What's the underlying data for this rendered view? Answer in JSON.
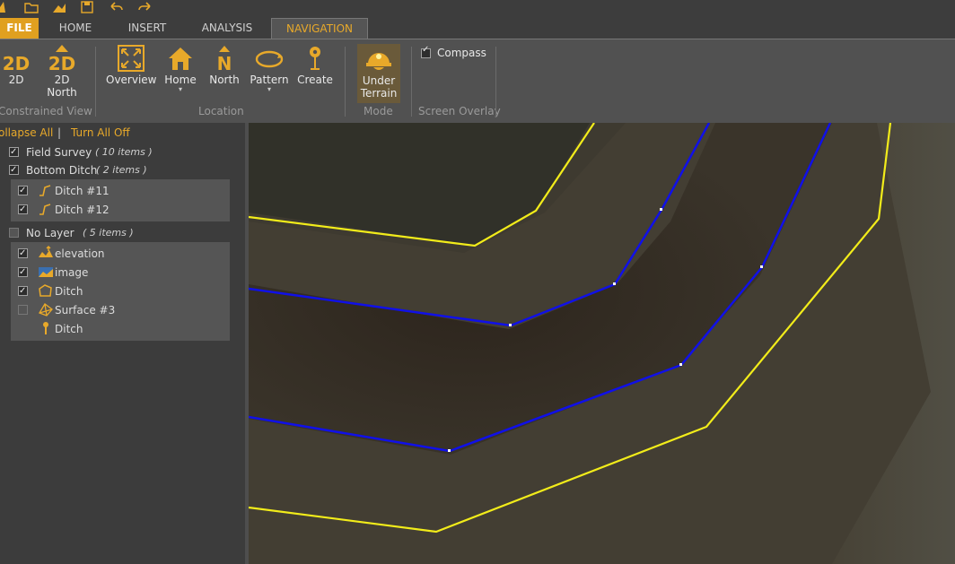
{
  "tabs": {
    "file": "FILE",
    "home": "HOME",
    "insert": "INSERT",
    "analysis": "ANALYSIS",
    "navigation": "NAVIGATION"
  },
  "ribbon": {
    "constrained_view": {
      "label": "Constrained View",
      "btn_2d_icon": "2D",
      "btn_2d": "2D",
      "btn_2dnorth_icon": "2D",
      "btn_2dnorth_line1": "2D",
      "btn_2dnorth_line2": "North"
    },
    "location": {
      "label": "Location",
      "overview": "Overview",
      "home": "Home",
      "north": "North",
      "pattern": "Pattern",
      "create": "Create"
    },
    "mode": {
      "label": "Mode",
      "under_line1": "Under",
      "under_line2": "Terrain"
    },
    "screen_overlay": {
      "label": "Screen Overlay",
      "compass": "Compass",
      "compass_checked": true
    }
  },
  "panel": {
    "collapse_all": "ollapse All",
    "separator": "|",
    "turn_all_off": "Turn All Off",
    "layers": [
      {
        "name": "Field Survey",
        "count": "( 10 items )",
        "checked": true
      },
      {
        "name": "Bottom Ditch",
        "count": "( 2 items )",
        "checked": true,
        "items": [
          {
            "name": "Ditch #11",
            "checked": true
          },
          {
            "name": "Ditch #12",
            "checked": true
          }
        ]
      },
      {
        "name": "No Layer",
        "count": "( 5 items )",
        "checked": false,
        "items": [
          {
            "name": "elevation",
            "checked": true
          },
          {
            "name": "image",
            "checked": true
          },
          {
            "name": "Ditch",
            "checked": true
          },
          {
            "name": "Surface #3",
            "checked": false
          },
          {
            "name": "Ditch",
            "checked": null
          }
        ]
      }
    ]
  },
  "colors": {
    "accent": "#e8a92a",
    "ditch_bottom": "#1010e8",
    "ditch_top": "#f2ec1a"
  }
}
